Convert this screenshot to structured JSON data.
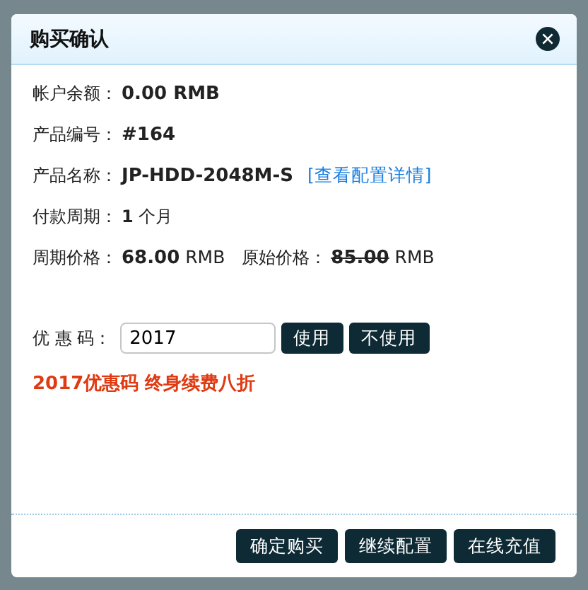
{
  "dialog": {
    "title": "购买确认",
    "rows": [
      {
        "kind": "text",
        "label": "帐户余额：",
        "value": "0.00 RMB",
        "bold": true
      },
      {
        "kind": "text",
        "label": "产品编号：",
        "value": "#164",
        "bold": true
      },
      {
        "kind": "link",
        "label": "产品名称：",
        "value": "JP-HDD-2048M-S",
        "bold": true,
        "link": "[查看配置详情]"
      },
      {
        "kind": "text",
        "label": "付款周期：",
        "value": "**1** 个月",
        "bold": false
      },
      {
        "kind": "price",
        "label": "周期价格：",
        "amount": "68.00",
        "unit": "RMB",
        "original_label": "原始价格：",
        "original_amount": "85.00",
        "original_unit": "RMB"
      }
    ],
    "coupon": {
      "label": "优 惠 码：",
      "value": "2017",
      "buttons": [
        "使用",
        "不使用"
      ]
    },
    "notice": "2017优惠码 终身续费八折",
    "footer_buttons": [
      "确定购买",
      "继续配置",
      "在线充值"
    ]
  }
}
